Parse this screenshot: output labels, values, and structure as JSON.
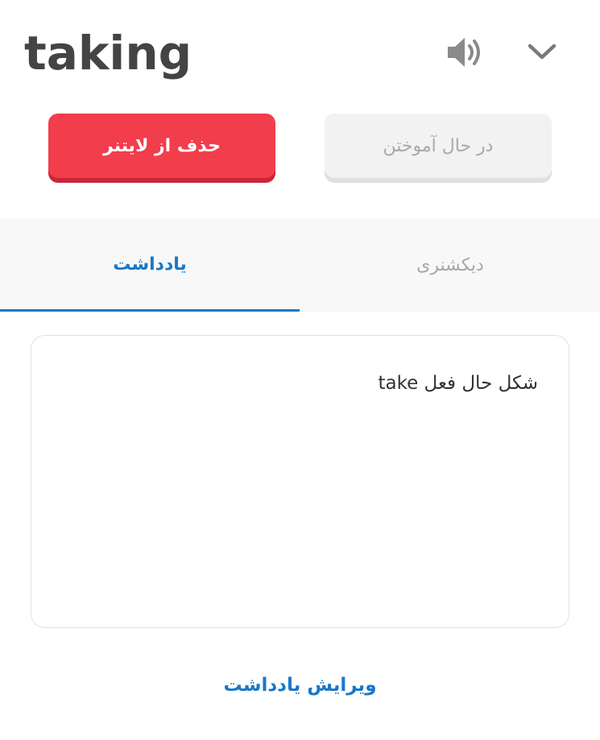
{
  "header": {
    "word": "taking",
    "speaker_icon": "speaker-icon",
    "chevron_icon": "chevron-down-icon"
  },
  "actions": {
    "delete_label": "حذف از لایتنر",
    "learning_label": "در حال آموختن"
  },
  "tabs": [
    {
      "label": "یادداشت",
      "active": true
    },
    {
      "label": "دیکشنری",
      "active": false
    }
  ],
  "note": {
    "text": "شکل حال فعل take",
    "edit_label": "ویرایش یادداشت"
  },
  "colors": {
    "accent": "#1a77c9",
    "danger": "#f23d4c",
    "muted": "#a8a8a8"
  }
}
